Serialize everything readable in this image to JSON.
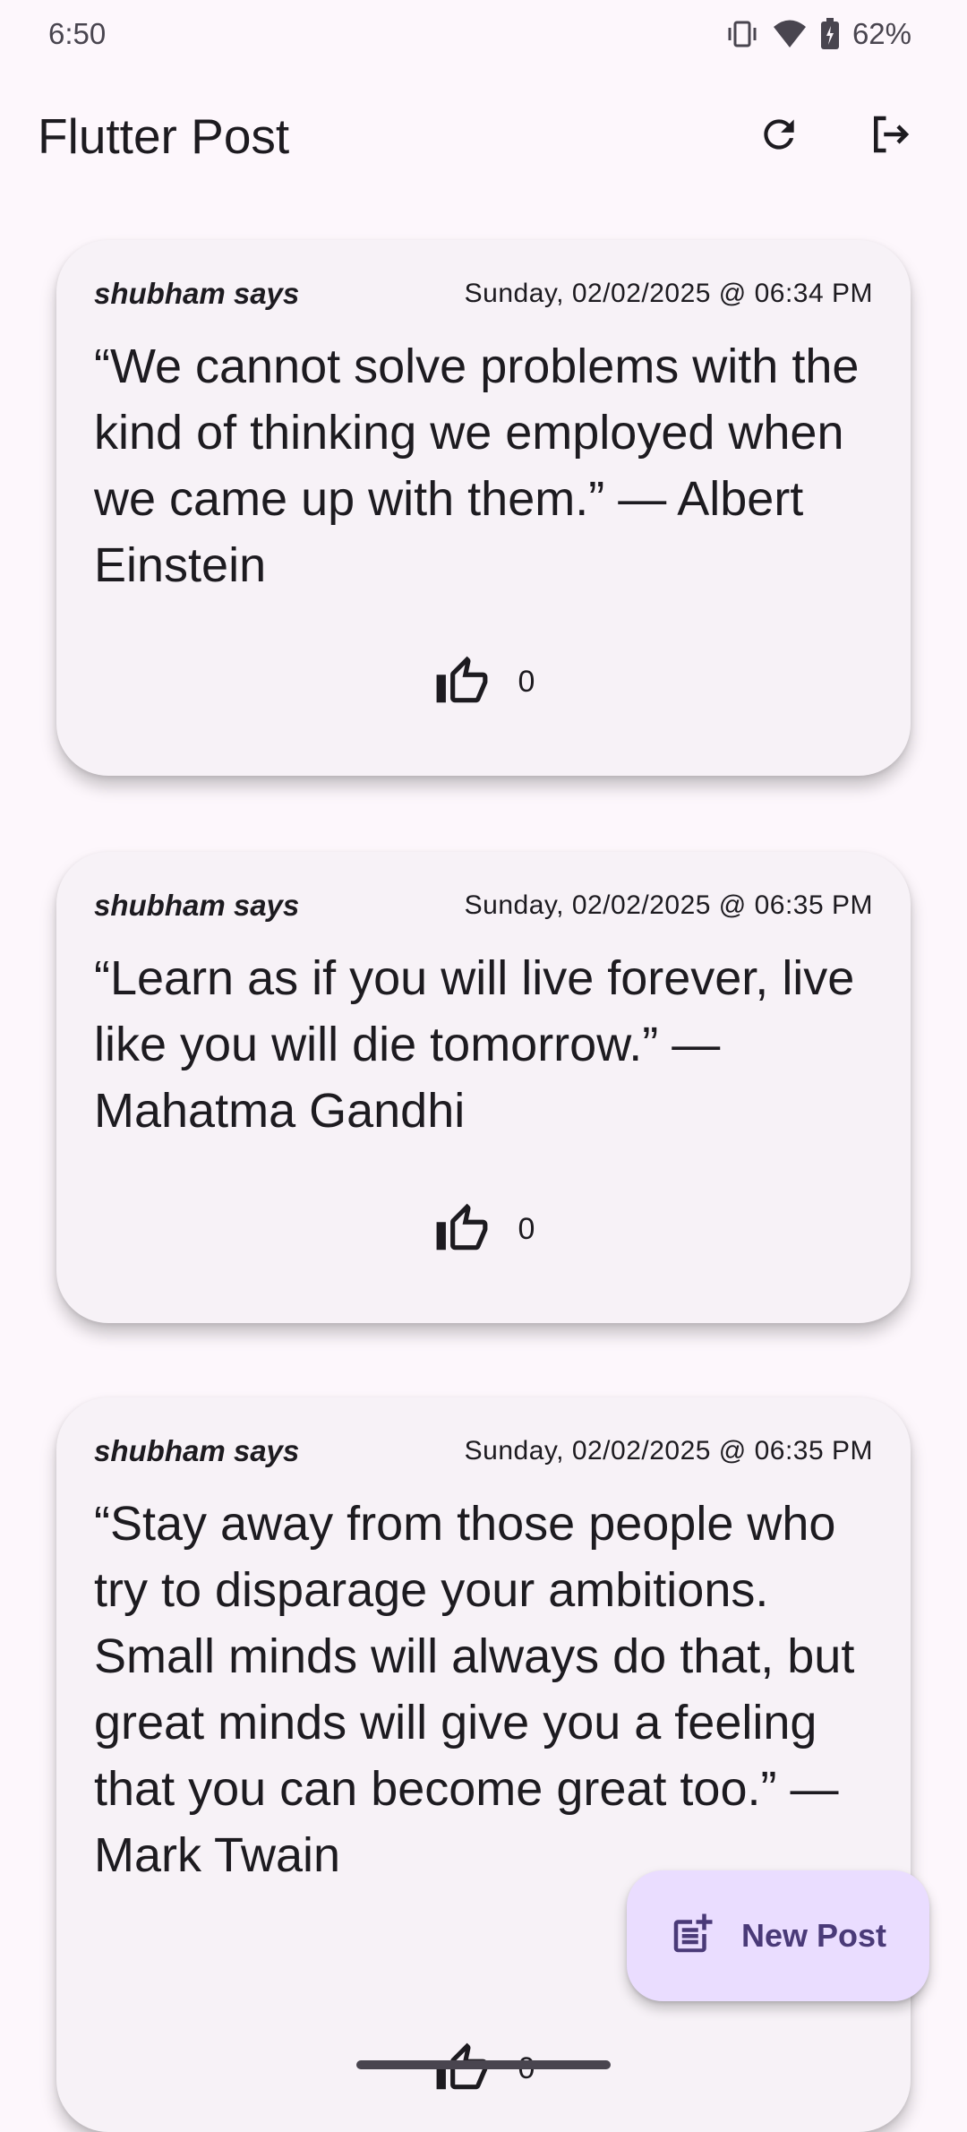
{
  "status_bar": {
    "time": "6:50",
    "battery": "62%"
  },
  "app_bar": {
    "title": "Flutter Post",
    "refresh_icon": "refresh-icon",
    "logout_icon": "logout-icon"
  },
  "posts": [
    {
      "author": "shubham says",
      "date": "Sunday, 02/02/2025 @ 06:34 PM",
      "text": "“We cannot solve problems with the kind of thinking we employed when we came up with them.” — Albert Einstein",
      "likes": "0"
    },
    {
      "author": "shubham says",
      "date": "Sunday, 02/02/2025 @ 06:35 PM",
      "text": "“Learn as if you will live forever, live like you will die tomorrow.” — Mahatma Gandhi",
      "likes": "0"
    },
    {
      "author": "shubham says",
      "date": "Sunday, 02/02/2025 @ 06:35 PM",
      "text": "“Stay away from those people who try to disparage your ambitions. Small minds will always do that, but great minds will give you a feeling that you can become great too.” —Mark Twain",
      "likes": "0"
    }
  ],
  "fab": {
    "label": "New Post",
    "icon": "post-add-icon"
  },
  "colors": {
    "background": "#fdf7fc",
    "card": "#f7f2f7",
    "fab": "#eaddff",
    "fab_text": "#4a3a78"
  }
}
